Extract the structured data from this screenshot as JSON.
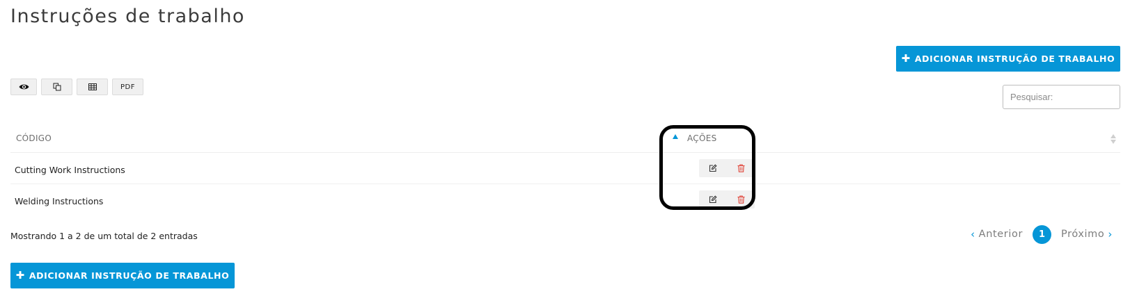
{
  "page": {
    "title": "Instruções de trabalho"
  },
  "buttons": {
    "add_top": {
      "icon": "plus-icon",
      "label": "ADICIONAR INSTRUÇÃO DE TRABALHO"
    },
    "add_bottom": {
      "icon": "plus-icon",
      "label": "ADICIONAR INSTRUÇÃO DE TRABALHO"
    }
  },
  "toolbar": {
    "view": {
      "icon": "eye-icon"
    },
    "copy": {
      "icon": "copy-icon"
    },
    "csv": {
      "icon": "table-grid-icon"
    },
    "pdf": {
      "label": "PDF"
    }
  },
  "search": {
    "placeholder": "Pesquisar:",
    "value": ""
  },
  "table": {
    "columns": [
      {
        "label": "CÓDIGO",
        "sort": "none"
      },
      {
        "label": "AÇÕES",
        "sort": "none"
      }
    ],
    "sorted_column": 0,
    "sort_direction": "asc",
    "rows": [
      {
        "code": "Cutting Work Instructions",
        "actions": [
          "edit-icon",
          "trash-icon"
        ]
      },
      {
        "code": "Welding Instructions",
        "actions": [
          "edit-icon",
          "trash-icon"
        ]
      }
    ]
  },
  "info": {
    "text": "Mostrando 1 a 2 de um total de 2 entradas"
  },
  "pagination": {
    "prev": "Anterior",
    "current": "1",
    "next": "Próximo"
  },
  "colors": {
    "accent": "#0696d7",
    "delete": "#e0453a",
    "highlight": "#000000"
  }
}
